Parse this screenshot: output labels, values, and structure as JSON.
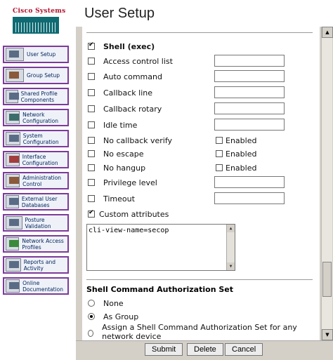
{
  "header": {
    "logo_text": "Cisco Systems",
    "title": "User Setup"
  },
  "nav": {
    "items": [
      {
        "label": "User Setup",
        "icon": "user-icon"
      },
      {
        "label": "Group Setup",
        "icon": "group-icon"
      },
      {
        "label": "Shared Profile Components",
        "icon": "shared-profile-icon"
      },
      {
        "label": "Network Configuration",
        "icon": "network-icon"
      },
      {
        "label": "System Configuration",
        "icon": "system-config-icon"
      },
      {
        "label": "Interface Configuration",
        "icon": "interface-config-icon"
      },
      {
        "label": "Administration Control",
        "icon": "admin-control-icon"
      },
      {
        "label": "External User Databases",
        "icon": "database-icon"
      },
      {
        "label": "Posture Validation",
        "icon": "posture-icon"
      },
      {
        "label": "Network Access Profiles",
        "icon": "network-access-icon"
      },
      {
        "label": "Reports and Activity",
        "icon": "reports-icon"
      },
      {
        "label": "Online Documentation",
        "icon": "documentation-icon"
      }
    ]
  },
  "shell": {
    "shell_exec_label": "Shell (exec)",
    "shell_exec_checked": true,
    "options": [
      {
        "label": "Access control list",
        "type": "text",
        "value": ""
      },
      {
        "label": "Auto command",
        "type": "text",
        "value": ""
      },
      {
        "label": "Callback line",
        "type": "text",
        "value": ""
      },
      {
        "label": "Callback rotary",
        "type": "text",
        "value": ""
      },
      {
        "label": "Idle time",
        "type": "text",
        "value": ""
      },
      {
        "label": "No callback verify",
        "type": "enabled",
        "enabled_label": "Enabled"
      },
      {
        "label": "No escape",
        "type": "enabled",
        "enabled_label": "Enabled"
      },
      {
        "label": "No hangup",
        "type": "enabled",
        "enabled_label": "Enabled"
      },
      {
        "label": "Privilege level",
        "type": "text",
        "value": ""
      },
      {
        "label": "Timeout",
        "type": "text",
        "value": ""
      }
    ],
    "custom_attributes_label": "Custom attributes",
    "custom_attributes_checked": true,
    "custom_attributes_value": "cli-view-name=secop"
  },
  "authorization": {
    "title": "Shell Command Authorization Set",
    "none_label": "None",
    "as_group_label": "As Group",
    "assign_label": "Assign a Shell Command Authorization Set for any network device",
    "selected": "As Group"
  },
  "buttons": {
    "submit": "Submit",
    "delete": "Delete",
    "cancel": "Cancel"
  }
}
